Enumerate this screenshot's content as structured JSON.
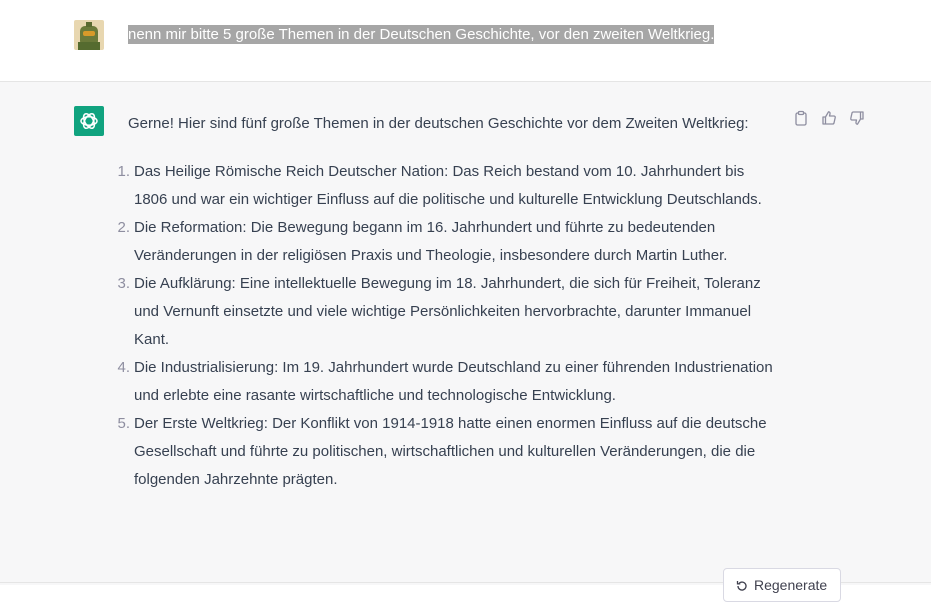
{
  "user_message": {
    "text": "nenn mir bitte 5 große Themen in der Deutschen Geschichte, vor den zweiten Weltkrieg."
  },
  "assistant_message": {
    "intro": "Gerne! Hier sind fünf große Themen in der deutschen Geschichte vor dem Zweiten Weltkrieg:",
    "items": [
      {
        "num": "1.",
        "text": "Das Heilige Römische Reich Deutscher Nation: Das Reich bestand vom 10. Jahrhundert bis 1806 und war ein wichtiger Einfluss auf die politische und kulturelle Entwicklung Deutschlands."
      },
      {
        "num": "2.",
        "text": "Die Reformation: Die Bewegung begann im 16. Jahrhundert und führte zu bedeutenden Veränderungen in der religiösen Praxis und Theologie, insbesondere durch Martin Luther."
      },
      {
        "num": "3.",
        "text": "Die Aufklärung: Eine intellektuelle Bewegung im 18. Jahrhundert, die sich für Freiheit, Toleranz und Vernunft einsetzte und viele wichtige Persönlichkeiten hervorbrachte, darunter Immanuel Kant."
      },
      {
        "num": "4.",
        "text": "Die Industrialisierung: Im 19. Jahrhundert wurde Deutschland zu einer führenden Industrienation und erlebte eine rasante wirtschaftliche und technologische Entwicklung."
      },
      {
        "num": "5.",
        "text": "Der Erste Weltkrieg: Der Konflikt von 1914-1918 hatte einen enormen Einfluss auf die deutsche Gesellschaft und führte zu politischen, wirtschaftlichen und kulturellen Veränderungen, die die folgenden Jahrzehnte prägten."
      }
    ]
  },
  "actions": {
    "copy_icon": "clipboard-icon",
    "like_icon": "thumbs-up-icon",
    "dislike_icon": "thumbs-down-icon"
  },
  "regenerate": {
    "label": "Regenerate",
    "icon": "refresh-icon"
  },
  "colors": {
    "bot_avatar": "#10a37f",
    "assistant_bg": "#f7f7f8",
    "user_highlight": "#a6a6a6"
  }
}
